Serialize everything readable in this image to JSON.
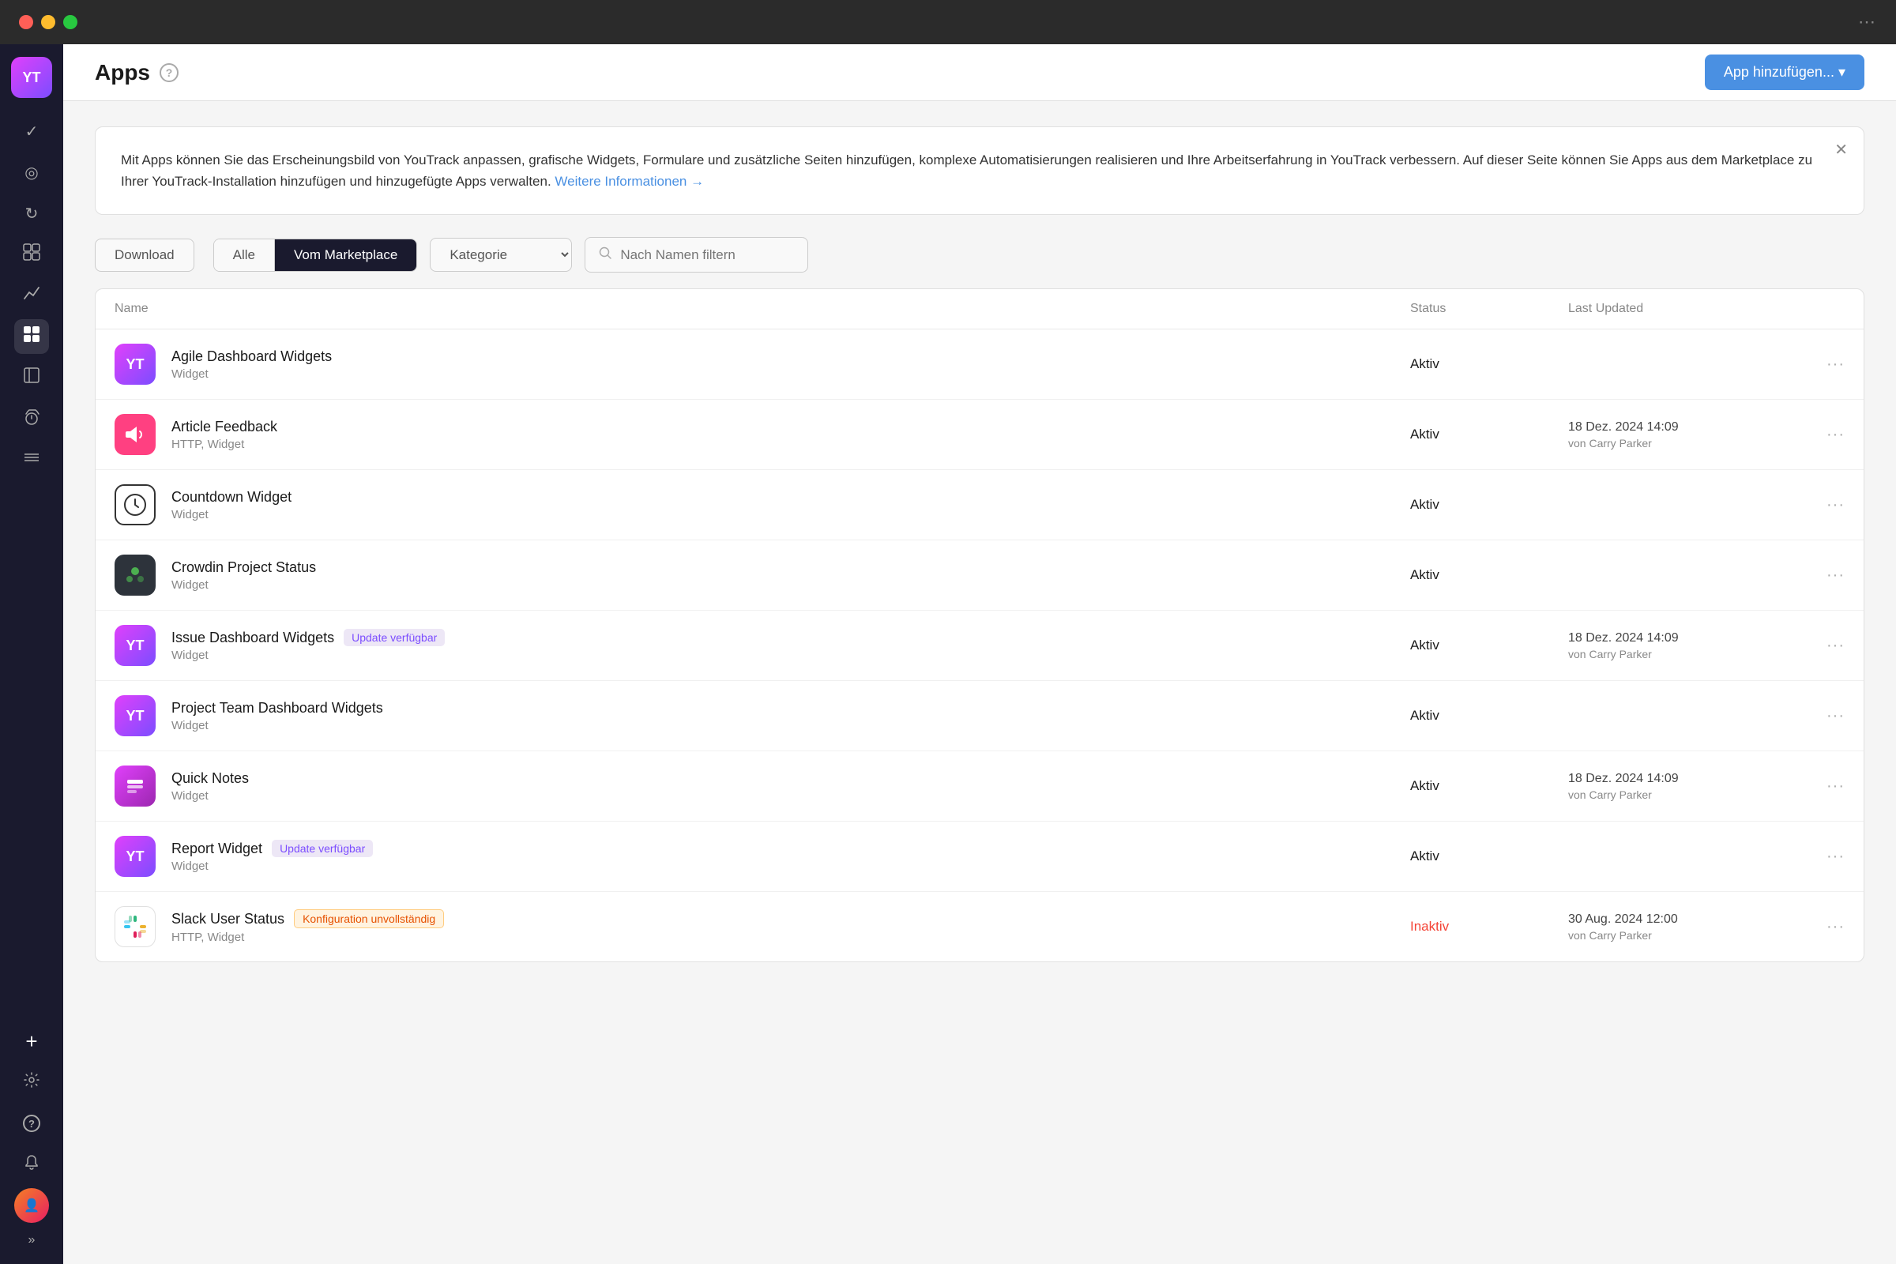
{
  "titlebar": {
    "more_icon": "⋯"
  },
  "sidebar": {
    "logo_text": "YT",
    "icons": [
      {
        "name": "check-icon",
        "symbol": "✓",
        "active": false
      },
      {
        "name": "circle-icon",
        "symbol": "◎",
        "active": false
      },
      {
        "name": "refresh-icon",
        "symbol": "↻",
        "active": false
      },
      {
        "name": "layout-icon",
        "symbol": "⊞",
        "active": false
      },
      {
        "name": "chart-icon",
        "symbol": "↗",
        "active": false
      },
      {
        "name": "apps-icon",
        "symbol": "⊞",
        "active": true
      },
      {
        "name": "book-icon",
        "symbol": "📖",
        "active": false
      },
      {
        "name": "timer-icon",
        "symbol": "⧖",
        "active": false
      },
      {
        "name": "layers-icon",
        "symbol": "≡",
        "active": false
      }
    ],
    "bottom_icons": [
      {
        "name": "plus-icon",
        "symbol": "+"
      },
      {
        "name": "gear-icon",
        "symbol": "⚙"
      },
      {
        "name": "help-icon",
        "symbol": "?"
      },
      {
        "name": "bell-icon",
        "symbol": "🔔"
      }
    ],
    "chevron_label": "»"
  },
  "header": {
    "title": "Apps",
    "help_tooltip": "?",
    "add_button_label": "App hinzufügen... ▾"
  },
  "info_banner": {
    "text": "Mit Apps können Sie das Erscheinungsbild von YouTrack anpassen, grafische Widgets, Formulare und zusätzliche Seiten hinzufügen, komplexe Automatisierungen realisieren und Ihre Arbeitserfahrung in YouTrack verbessern. Auf dieser Seite können Sie Apps aus dem Marketplace zu Ihrer YouTrack-Installation hinzufügen und hinzugefügte Apps verwalten.",
    "link_text": "Weitere Informationen →",
    "close": "✕"
  },
  "toolbar": {
    "download_label": "Download",
    "filter_alle": "Alle",
    "filter_marketplace": "Vom Marketplace",
    "category_placeholder": "Kategorie",
    "search_placeholder": "Nach Namen filtern",
    "search_icon": "🔍"
  },
  "table": {
    "col_name": "Name",
    "col_status": "Status",
    "col_updated": "Last Updated",
    "rows": [
      {
        "name": "Agile Dashboard Widgets",
        "category": "Widget",
        "icon_type": "yt",
        "status": "Aktiv",
        "status_type": "aktiv",
        "updated": "",
        "updated_by": "",
        "badge": "",
        "badge_type": ""
      },
      {
        "name": "Article Feedback",
        "category": "HTTP, Widget",
        "icon_type": "megaphone",
        "status": "Aktiv",
        "status_type": "aktiv",
        "updated": "18 Dez. 2024 14:09",
        "updated_by": "von Carry Parker",
        "badge": "",
        "badge_type": ""
      },
      {
        "name": "Countdown Widget",
        "category": "Widget",
        "icon_type": "clock",
        "status": "Aktiv",
        "status_type": "aktiv",
        "updated": "",
        "updated_by": "",
        "badge": "",
        "badge_type": ""
      },
      {
        "name": "Crowdin Project Status",
        "category": "Widget",
        "icon_type": "crowdin",
        "status": "Aktiv",
        "status_type": "aktiv",
        "updated": "",
        "updated_by": "",
        "badge": "",
        "badge_type": ""
      },
      {
        "name": "Issue Dashboard Widgets",
        "category": "Widget",
        "icon_type": "yt",
        "status": "Aktiv",
        "status_type": "aktiv",
        "updated": "18 Dez. 2024 14:09",
        "updated_by": "von Carry Parker",
        "badge": "Update verfügbar",
        "badge_type": "update"
      },
      {
        "name": "Project Team Dashboard Widgets",
        "category": "Widget",
        "icon_type": "yt",
        "status": "Aktiv",
        "status_type": "aktiv",
        "updated": "",
        "updated_by": "",
        "badge": "",
        "badge_type": ""
      },
      {
        "name": "Quick Notes",
        "category": "Widget",
        "icon_type": "notes",
        "status": "Aktiv",
        "status_type": "aktiv",
        "updated": "18 Dez. 2024 14:09",
        "updated_by": "von Carry Parker",
        "badge": "",
        "badge_type": ""
      },
      {
        "name": "Report Widget",
        "category": "Widget",
        "icon_type": "yt",
        "status": "Aktiv",
        "status_type": "aktiv",
        "updated": "",
        "updated_by": "",
        "badge": "Update verfügbar",
        "badge_type": "update"
      },
      {
        "name": "Slack User Status",
        "category": "HTTP, Widget",
        "icon_type": "slack",
        "status": "Inaktiv",
        "status_type": "inaktiv",
        "updated": "30 Aug. 2024 12:00",
        "updated_by": "von Carry Parker",
        "badge": "Konfiguration unvollständig",
        "badge_type": "config"
      }
    ]
  },
  "colors": {
    "accent": "#4a90e2",
    "sidebar_bg": "#1a1a2e",
    "active_filter_bg": "#1a1a2e"
  }
}
